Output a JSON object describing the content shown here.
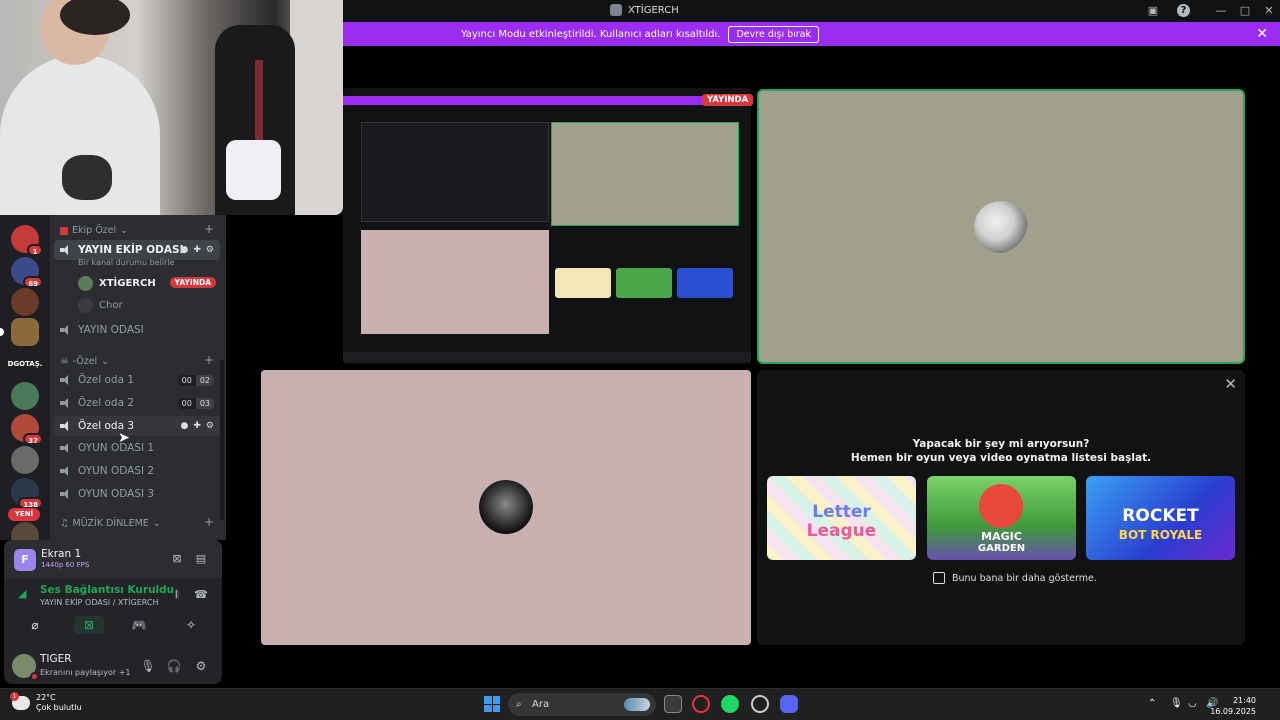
{
  "window": {
    "title": "XTİGERCH"
  },
  "banner": {
    "message": "Yayıncı Modu etkinleştirildi. Kullanıcı adları kısaltıldı.",
    "button": "Devre dışı bırak"
  },
  "rail": {
    "badges": [
      "1",
      "69",
      "37",
      "138",
      "95"
    ],
    "server_label": "DGOTAŞ.",
    "new_label": "YENİ"
  },
  "channels": {
    "categories": [
      {
        "label": "Ekip Özel"
      },
      {
        "label": "-Özel"
      },
      {
        "label": "MÜZİK DİNLEME"
      }
    ],
    "items": [
      {
        "label": "YAYIN EKİP ODASI",
        "status": "Bir kanal durumu belirle"
      },
      {
        "label": "YAYIN ODASI"
      },
      {
        "label": "Özel oda 1",
        "count_a": "00",
        "count_b": "02"
      },
      {
        "label": "Özel oda 2",
        "count_a": "00",
        "count_b": "03"
      },
      {
        "label": "Özel oda 3"
      },
      {
        "label": "OYUN ODASI 1"
      },
      {
        "label": "OYUN ODASI 2"
      },
      {
        "label": "OYUN ODASI 3"
      }
    ],
    "members": [
      {
        "name": "XTİGERCH",
        "badge": "YAYINDA"
      },
      {
        "name": "Chor"
      }
    ]
  },
  "panel": {
    "screen": {
      "icon_letter": "F",
      "title": "Ekran 1",
      "sub": "1440p 60 FPS"
    },
    "voice": {
      "title": "Ses Bağlantısı Kuruldu",
      "sub": "YAYIN EKİP ODASI / XTİGERCH"
    },
    "user": {
      "name": "TIGER",
      "status": "Ekranını paylaşıyor +1"
    }
  },
  "stream": {
    "live_label": "YAYINDA"
  },
  "activity": {
    "title": "Yapacak bir şey mi arıyorsun?",
    "subtitle": "Hemen bir oyun veya video oynatma listesi başlat.",
    "games": [
      {
        "name": "Letter League",
        "line1": "Letter",
        "line2": "League"
      },
      {
        "name": "Magic Garden",
        "line1": "MAGIC",
        "line2": "GARDEN"
      },
      {
        "name": "Rocket Bot Royale",
        "line1": "ROCKET",
        "line2": "BOT ROYALE"
      }
    ],
    "checkbox": "Bunu bana bir daha gösterme."
  },
  "taskbar": {
    "weather_temp": "22°C",
    "weather_desc": "Çok bulutlu",
    "weather_badge": "1",
    "search_placeholder": "Ara",
    "time": "21:40",
    "date": "16.09.2025"
  },
  "colors": {
    "accent": "#9b2df3",
    "live": "#da373c",
    "connected": "#23a55a"
  }
}
